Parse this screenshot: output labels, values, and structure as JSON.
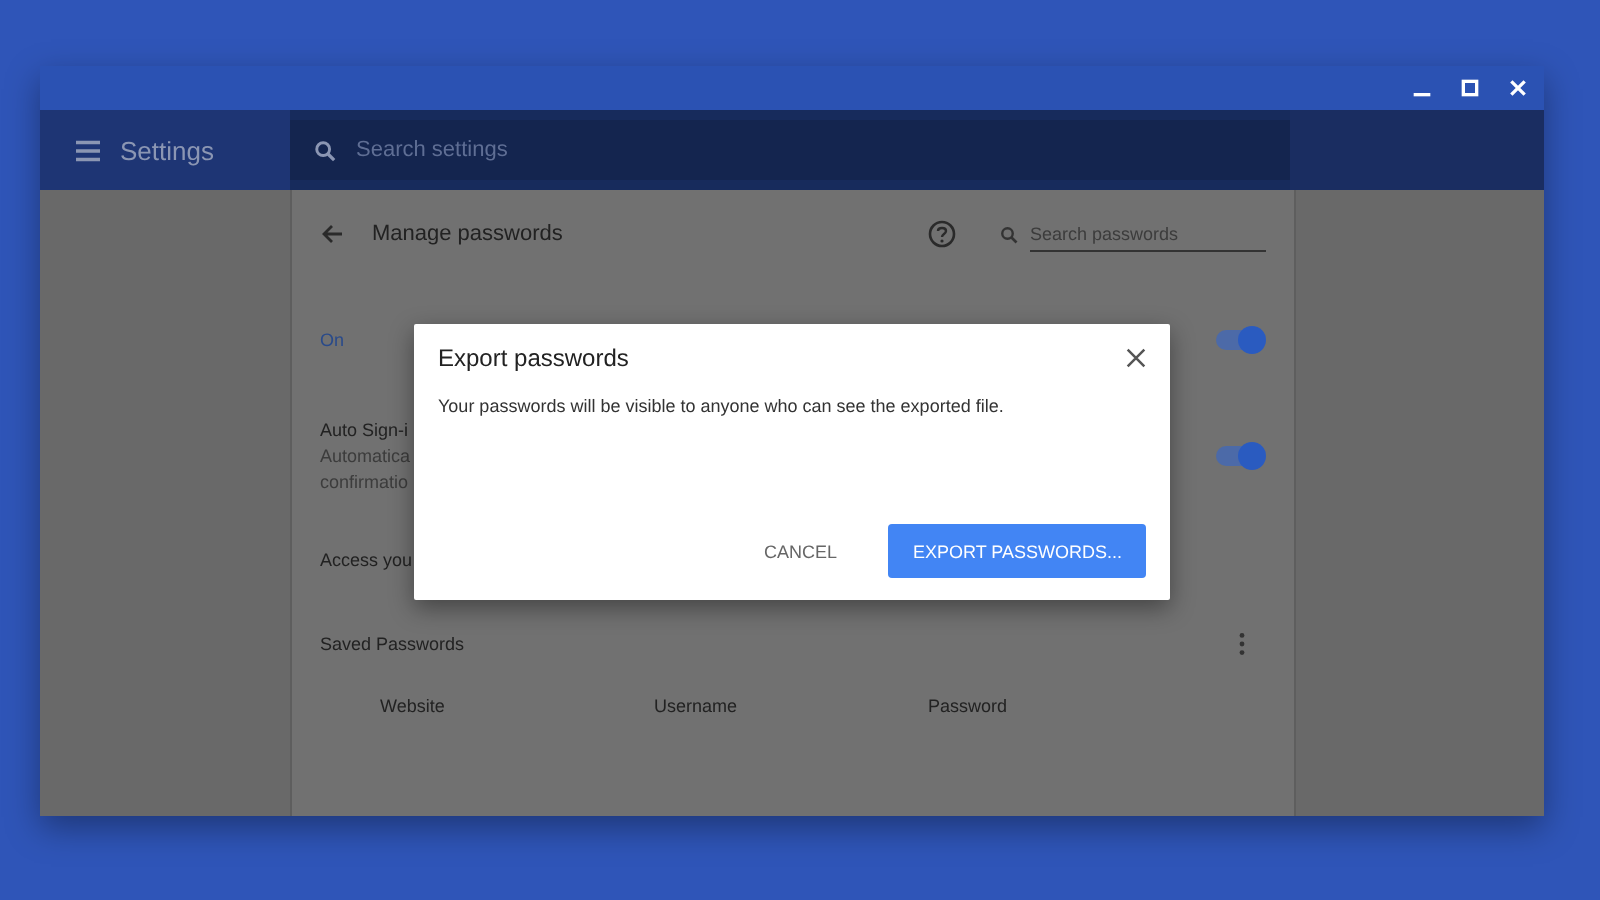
{
  "header": {
    "title": "Settings",
    "search": {
      "placeholder": "Search settings"
    }
  },
  "page": {
    "title": "Manage passwords",
    "search": {
      "placeholder": "Search passwords"
    },
    "settings": [
      {
        "kind": "toggle",
        "label": "On",
        "on": true
      },
      {
        "kind": "toggle",
        "label": "Auto Sign-i",
        "description": [
          "Automatica",
          "confirmatio"
        ],
        "on": true
      },
      {
        "kind": "text",
        "label": "Access you"
      }
    ],
    "saved": {
      "title": "Saved Passwords",
      "columns": [
        "Website",
        "Username",
        "Password"
      ]
    }
  },
  "dialog": {
    "title": "Export passwords",
    "message": "Your passwords will be visible to anyone who can see the exported file.",
    "buttons": [
      {
        "label": "CANCEL",
        "kind": "text"
      },
      {
        "label": "EXPORT PASSWORDS...",
        "kind": "primary"
      }
    ]
  }
}
